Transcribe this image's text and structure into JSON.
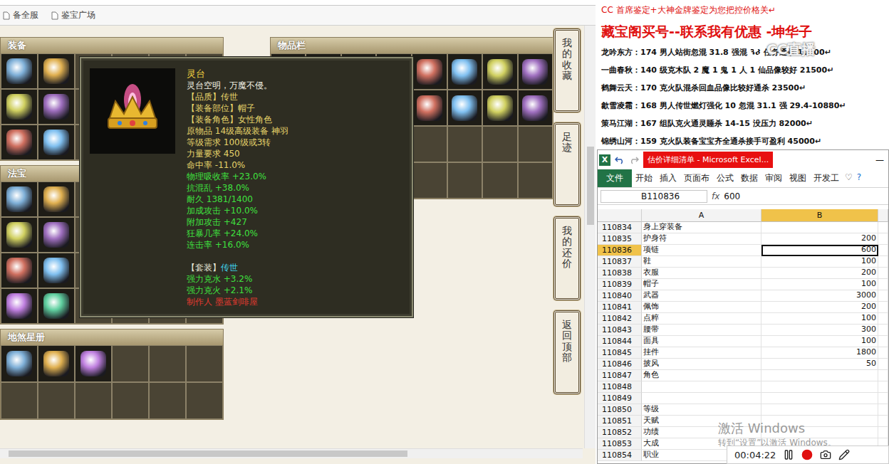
{
  "browser": {
    "bookmarks": [
      "备全服",
      "鉴宝广场"
    ]
  },
  "panels": {
    "equipment": {
      "title": "装备",
      "slots": [
        true,
        true,
        false,
        false,
        false,
        false,
        true,
        true,
        false,
        false,
        false,
        false,
        true,
        true,
        false,
        false,
        false,
        false
      ]
    },
    "inventory": {
      "title": "物品栏",
      "slots": [
        true,
        true,
        true,
        true,
        true,
        true,
        true,
        true,
        true,
        true,
        true,
        true,
        true,
        true,
        true,
        true,
        false,
        false,
        false,
        false,
        false,
        false,
        false,
        false,
        false,
        false,
        false,
        false,
        false,
        false,
        false,
        false
      ]
    },
    "fabao": {
      "title": "法宝",
      "slots": [
        true,
        true,
        false,
        false,
        false,
        false,
        true,
        true,
        false,
        false,
        false,
        false,
        true,
        true,
        false,
        false,
        false,
        false,
        true,
        true,
        false,
        false,
        false,
        false
      ]
    },
    "xingce": {
      "title": "地煞星册",
      "slots": [
        true,
        true,
        true,
        false,
        false,
        false,
        false,
        false,
        false,
        false,
        false,
        false
      ]
    }
  },
  "tooltip": {
    "name": "灵台",
    "lines": [
      {
        "parts": [
          {
            "text": "灵台空明，万魔不侵。",
            "color": "#f2f2e4"
          }
        ],
        "gap": false
      },
      {
        "parts": [
          {
            "text": "【品质】传世",
            "color": "#e6d46a"
          }
        ],
        "gap": false
      },
      {
        "parts": [
          {
            "text": "【装备部位】帽子",
            "color": "#e6d46a"
          }
        ],
        "gap": false
      },
      {
        "parts": [
          {
            "text": "【装备角色】女性角色",
            "color": "#e6d46a"
          }
        ],
        "gap": false
      },
      {
        "parts": [
          {
            "text": "原物品 14级高级装备 神羽",
            "color": "#e6d46a"
          }
        ],
        "gap": false
      },
      {
        "parts": [
          {
            "text": "等级需求 100级或3转",
            "color": "#e6d46a"
          }
        ],
        "gap": false
      },
      {
        "parts": [
          {
            "text": "力量要求 450",
            "color": "#e6d46a"
          }
        ],
        "gap": false
      },
      {
        "parts": [
          {
            "text": "命中率 -11.0%",
            "color": "#e6d46a"
          }
        ],
        "gap": false
      },
      {
        "parts": [
          {
            "text": "物理吸收率 +23.0%",
            "color": "#3fe03f"
          }
        ],
        "gap": false
      },
      {
        "parts": [
          {
            "text": "抗混乱 +38.0%",
            "color": "#3fe03f"
          }
        ],
        "gap": false
      },
      {
        "parts": [
          {
            "text": "耐久 1381/1400",
            "color": "#3fe03f"
          }
        ],
        "gap": false
      },
      {
        "parts": [
          {
            "text": "加成攻击 +10.0%",
            "color": "#3fe03f"
          }
        ],
        "gap": false
      },
      {
        "parts": [
          {
            "text": "附加攻击 +427",
            "color": "#3fe03f"
          }
        ],
        "gap": false
      },
      {
        "parts": [
          {
            "text": "狂暴几率 +24.0%",
            "color": "#3fe03f"
          }
        ],
        "gap": false
      },
      {
        "parts": [
          {
            "text": "连击率 +16.0%",
            "color": "#3fe03f"
          }
        ],
        "gap": false
      },
      {
        "parts": [
          {
            "text": "【套装】",
            "color": "#e8e8d8"
          },
          {
            "text": "传世",
            "color": "#3fd6f0"
          }
        ],
        "gap": true
      },
      {
        "parts": [
          {
            "text": "强力克水 +3.2%",
            "color": "#3fe03f"
          }
        ],
        "gap": false
      },
      {
        "parts": [
          {
            "text": "强力克火 +2.1%",
            "color": "#3fe03f"
          }
        ],
        "gap": false
      },
      {
        "parts": [
          {
            "text": "制作人 墨蓝剑啡屋",
            "color": "#e03a30"
          }
        ],
        "gap": false
      }
    ]
  },
  "side_buttons": [
    "我的收藏",
    "足迹",
    "我的还价",
    "返回顶部"
  ],
  "doc": {
    "subtitle": "CC 首席鉴定+大神金牌鉴定为您把控价格关↵",
    "headline": "藏宝阁买号--联系我有优惠 -坤华子",
    "lines": [
      "龙吟东方：174 男人站街忽混 31.8 强混 38 任务通杀 10000↵",
      "一曲春秋：140 级克木队 2 魔 1 鬼 1 人 1 仙品像较好 21500↵",
      "鹤舞云天：170 克火队混杀回血品像比较好通杀 23500↵",
      "歙雪凌霜：168 男人传世燃灯强化 10 忽混 31.1 强 29.4-10880↵",
      "策马江湖：167 组队克火通灵睡杀 14-15 没压力 82000↵",
      "锦绣山河：159 克火队装备宝宝齐全通杀接手可盈利 45000↵"
    ]
  },
  "stream_watermark": "CC直播",
  "excel": {
    "app_icon": "X",
    "title": "估价详细清单 - Microsoft Excel...",
    "minimize": "—",
    "tabs": [
      {
        "label": "文件",
        "selected": true
      },
      {
        "label": "开始",
        "selected": false
      },
      {
        "label": "插入",
        "selected": false
      },
      {
        "label": "页面布",
        "selected": false
      },
      {
        "label": "公式",
        "selected": false
      },
      {
        "label": "数据",
        "selected": false
      },
      {
        "label": "审阅",
        "selected": false
      },
      {
        "label": "视图",
        "selected": false
      },
      {
        "label": "开发工",
        "selected": false
      }
    ],
    "ribbon_icons": [
      "♡",
      "?"
    ],
    "name_box": "B110836",
    "fx": "fx",
    "formula": "600",
    "columns": [
      {
        "label": "A",
        "selected": false
      },
      {
        "label": "B",
        "selected": true
      }
    ],
    "rows": [
      {
        "num": "110834",
        "a": "身上穿装备",
        "b": "",
        "selected": false
      },
      {
        "num": "110835",
        "a": "护身符",
        "b": "200",
        "selected": false
      },
      {
        "num": "110836",
        "a": "项链",
        "b": "600",
        "selected": true
      },
      {
        "num": "110837",
        "a": "鞋",
        "b": "100",
        "selected": false
      },
      {
        "num": "110838",
        "a": "衣服",
        "b": "200",
        "selected": false
      },
      {
        "num": "110839",
        "a": "帽子",
        "b": "100",
        "selected": false
      },
      {
        "num": "110840",
        "a": "武器",
        "b": "3000",
        "selected": false
      },
      {
        "num": "110841",
        "a": "佩饰",
        "b": "200",
        "selected": false
      },
      {
        "num": "110842",
        "a": "点粹",
        "b": "100",
        "selected": false
      },
      {
        "num": "110843",
        "a": "腰带",
        "b": "300",
        "selected": false
      },
      {
        "num": "110844",
        "a": "面具",
        "b": "100",
        "selected": false
      },
      {
        "num": "110845",
        "a": "挂件",
        "b": "1800",
        "selected": false
      },
      {
        "num": "110846",
        "a": "披风",
        "b": "50",
        "selected": false
      },
      {
        "num": "110847",
        "a": "角色",
        "b": "",
        "selected": false
      },
      {
        "num": "110848",
        "a": "",
        "b": "",
        "selected": false
      },
      {
        "num": "110849",
        "a": "",
        "b": "",
        "selected": false
      },
      {
        "num": "110850",
        "a": "等级",
        "b": "",
        "selected": false
      },
      {
        "num": "110851",
        "a": "天赋",
        "b": "",
        "selected": false
      },
      {
        "num": "110852",
        "a": "功绩",
        "b": "",
        "selected": false
      },
      {
        "num": "110853",
        "a": "大成",
        "b": "",
        "selected": false
      },
      {
        "num": "110854",
        "a": "职业",
        "b": "",
        "selected": false
      }
    ]
  },
  "activation": {
    "title": "激活 Windows",
    "hint": "转到“设置”以激活 Windows。"
  },
  "recorder": {
    "time": "00:04:22"
  }
}
